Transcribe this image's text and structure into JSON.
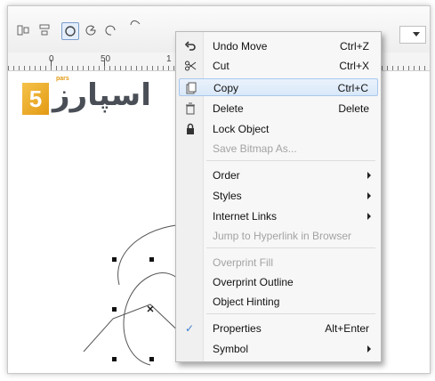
{
  "toolbar": {
    "tools": [
      {
        "name": "align-icon"
      },
      {
        "name": "distribute-icon"
      },
      {
        "name": "ellipse-tool-icon"
      },
      {
        "name": "pie-tool-icon"
      },
      {
        "name": "arc-tool-icon"
      }
    ]
  },
  "ruler": {
    "labels": [
      "0",
      "50",
      "1"
    ]
  },
  "logo": {
    "text": "اسپارز",
    "small": "pars",
    "digit": "5"
  },
  "context_menu": {
    "items": [
      {
        "icon": "undo-icon",
        "label": "Undo Move",
        "shortcut": "Ctrl+Z",
        "enabled": true
      },
      {
        "icon": "cut-icon",
        "label": "Cut",
        "shortcut": "Ctrl+X",
        "enabled": true
      },
      {
        "icon": "copy-icon",
        "label": "Copy",
        "shortcut": "Ctrl+C",
        "enabled": true,
        "highlighted": true
      },
      {
        "icon": "delete-icon",
        "label": "Delete",
        "shortcut": "Delete",
        "enabled": true
      },
      {
        "icon": "lock-icon",
        "label": "Lock Object",
        "shortcut": "",
        "enabled": true
      },
      {
        "icon": "",
        "label": "Save Bitmap As...",
        "shortcut": "",
        "enabled": false
      },
      {
        "icon": "",
        "label": "Order",
        "shortcut": "",
        "enabled": true,
        "submenu": true
      },
      {
        "icon": "",
        "label": "Styles",
        "shortcut": "",
        "enabled": true,
        "submenu": true
      },
      {
        "icon": "",
        "label": "Internet Links",
        "shortcut": "",
        "enabled": true,
        "submenu": true
      },
      {
        "icon": "",
        "label": "Jump to Hyperlink in Browser",
        "shortcut": "",
        "enabled": false
      },
      {
        "icon": "",
        "label": "Overprint Fill",
        "shortcut": "",
        "enabled": false
      },
      {
        "icon": "",
        "label": "Overprint Outline",
        "shortcut": "",
        "enabled": true
      },
      {
        "icon": "",
        "label": "Object Hinting",
        "shortcut": "",
        "enabled": true
      },
      {
        "icon": "checkmark-icon",
        "label": "Properties",
        "shortcut": "Alt+Enter",
        "enabled": true,
        "checked": true
      },
      {
        "icon": "",
        "label": "Symbol",
        "shortcut": "",
        "enabled": true,
        "submenu": true
      }
    ]
  },
  "colors": {
    "highlight": "#d9e8f9",
    "highlight_border": "#a9c7ec",
    "disabled_text": "#a3a3a3",
    "logo_orange": "#e39a14",
    "logo_text": "#4a4f57"
  }
}
